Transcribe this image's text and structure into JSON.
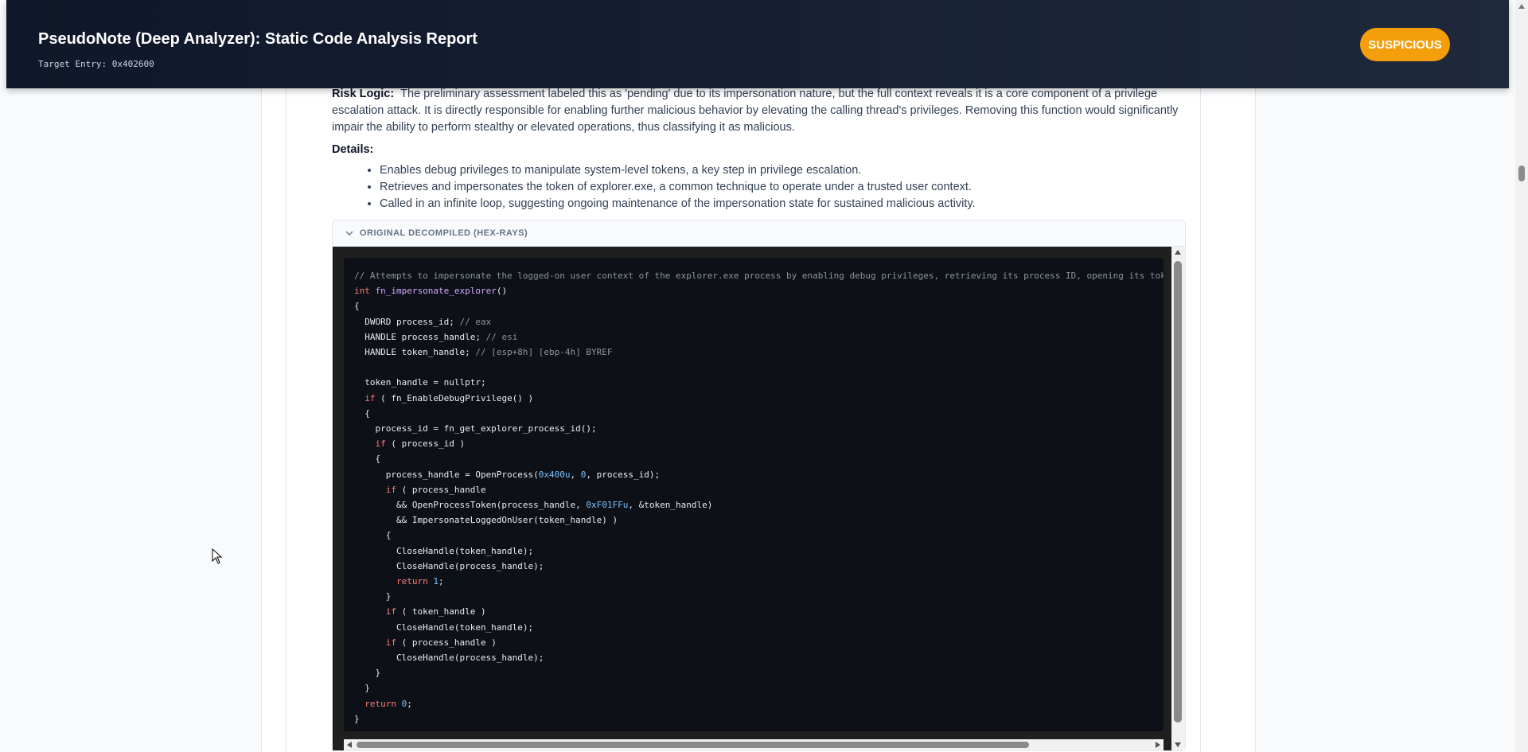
{
  "header": {
    "title": "PseudoNote (Deep Analyzer): Static Code Analysis Report",
    "subtitle": "Target Entry: 0x402600",
    "badge": "SUSPICIOUS"
  },
  "risk": {
    "label": "Risk Logic:",
    "text": "The preliminary assessment labeled this as 'pending' due to its impersonation nature, but the full context reveals it is a core component of a privilege escalation attack. It is directly responsible for enabling further malicious behavior by elevating the calling thread's privileges. Removing this function would significantly impair the ability to perform stealthy or elevated operations, thus classifying it as malicious."
  },
  "details": {
    "label": "Details:",
    "items": [
      "Enables debug privileges to manipulate system-level tokens, a key step in privilege escalation.",
      "Retrieves and impersonates the token of explorer.exe, a common technique to operate under a trusted user context.",
      "Called in an infinite loop, suggesting ongoing maintenance of the impersonation state for sustained malicious activity."
    ]
  },
  "decompiled": {
    "label": "ORIGINAL DECOMPILED (HEX-RAYS)",
    "lines": [
      [
        [
          "c-com",
          "// Attempts to impersonate the logged-on user context of the explorer.exe process by enabling debug privileges, retrieving its process ID, opening its tok"
        ]
      ],
      [
        [
          "c-kw",
          "int"
        ],
        [
          "",
          " "
        ],
        [
          "c-fn",
          "fn_impersonate_explorer"
        ],
        [
          "",
          "()"
        ]
      ],
      [
        [
          "",
          "{"
        ]
      ],
      [
        [
          "",
          "  DWORD process_id; "
        ],
        [
          "c-com",
          "// eax"
        ]
      ],
      [
        [
          "",
          "  HANDLE process_handle; "
        ],
        [
          "c-com",
          "// esi"
        ]
      ],
      [
        [
          "",
          "  HANDLE token_handle; "
        ],
        [
          "c-com",
          "// [esp+8h] [ebp-4h] BYREF"
        ]
      ],
      [
        [
          "",
          ""
        ]
      ],
      [
        [
          "",
          "  token_handle = nullptr;"
        ]
      ],
      [
        [
          "",
          "  "
        ],
        [
          "c-kw",
          "if"
        ],
        [
          "",
          " ( fn_EnableDebugPrivilege() )"
        ]
      ],
      [
        [
          "",
          "  {"
        ]
      ],
      [
        [
          "",
          "    process_id = fn_get_explorer_process_id();"
        ]
      ],
      [
        [
          "",
          "    "
        ],
        [
          "c-kw",
          "if"
        ],
        [
          "",
          " ( process_id )"
        ]
      ],
      [
        [
          "",
          "    {"
        ]
      ],
      [
        [
          "",
          "      process_handle = OpenProcess("
        ],
        [
          "c-num",
          "0x400u"
        ],
        [
          "",
          ", "
        ],
        [
          "c-num",
          "0"
        ],
        [
          "",
          ", process_id);"
        ]
      ],
      [
        [
          "",
          "      "
        ],
        [
          "c-kw",
          "if"
        ],
        [
          "",
          " ( process_handle"
        ]
      ],
      [
        [
          "",
          "        && OpenProcessToken(process_handle, "
        ],
        [
          "c-num",
          "0xF01FFu"
        ],
        [
          "",
          ", &token_handle)"
        ]
      ],
      [
        [
          "",
          "        && ImpersonateLoggedOnUser(token_handle) )"
        ]
      ],
      [
        [
          "",
          "      {"
        ]
      ],
      [
        [
          "",
          "        CloseHandle(token_handle);"
        ]
      ],
      [
        [
          "",
          "        CloseHandle(process_handle);"
        ]
      ],
      [
        [
          "",
          "        "
        ],
        [
          "c-kw",
          "return"
        ],
        [
          "",
          " "
        ],
        [
          "c-num",
          "1"
        ],
        [
          "",
          ";"
        ]
      ],
      [
        [
          "",
          "      }"
        ]
      ],
      [
        [
          "",
          "      "
        ],
        [
          "c-kw",
          "if"
        ],
        [
          "",
          " ( token_handle )"
        ]
      ],
      [
        [
          "",
          "        CloseHandle(token_handle);"
        ]
      ],
      [
        [
          "",
          "      "
        ],
        [
          "c-kw",
          "if"
        ],
        [
          "",
          " ( process_handle )"
        ]
      ],
      [
        [
          "",
          "        CloseHandle(process_handle);"
        ]
      ],
      [
        [
          "",
          "    }"
        ]
      ],
      [
        [
          "",
          "  }"
        ]
      ],
      [
        [
          "",
          "  "
        ],
        [
          "c-kw",
          "return"
        ],
        [
          "",
          " "
        ],
        [
          "c-num",
          "0"
        ],
        [
          "",
          ";"
        ]
      ],
      [
        [
          "",
          "}"
        ]
      ]
    ]
  },
  "colors": {
    "badge": "#f59e0b",
    "header_bg": "#0f172a",
    "code_bg": "#0d1117"
  }
}
